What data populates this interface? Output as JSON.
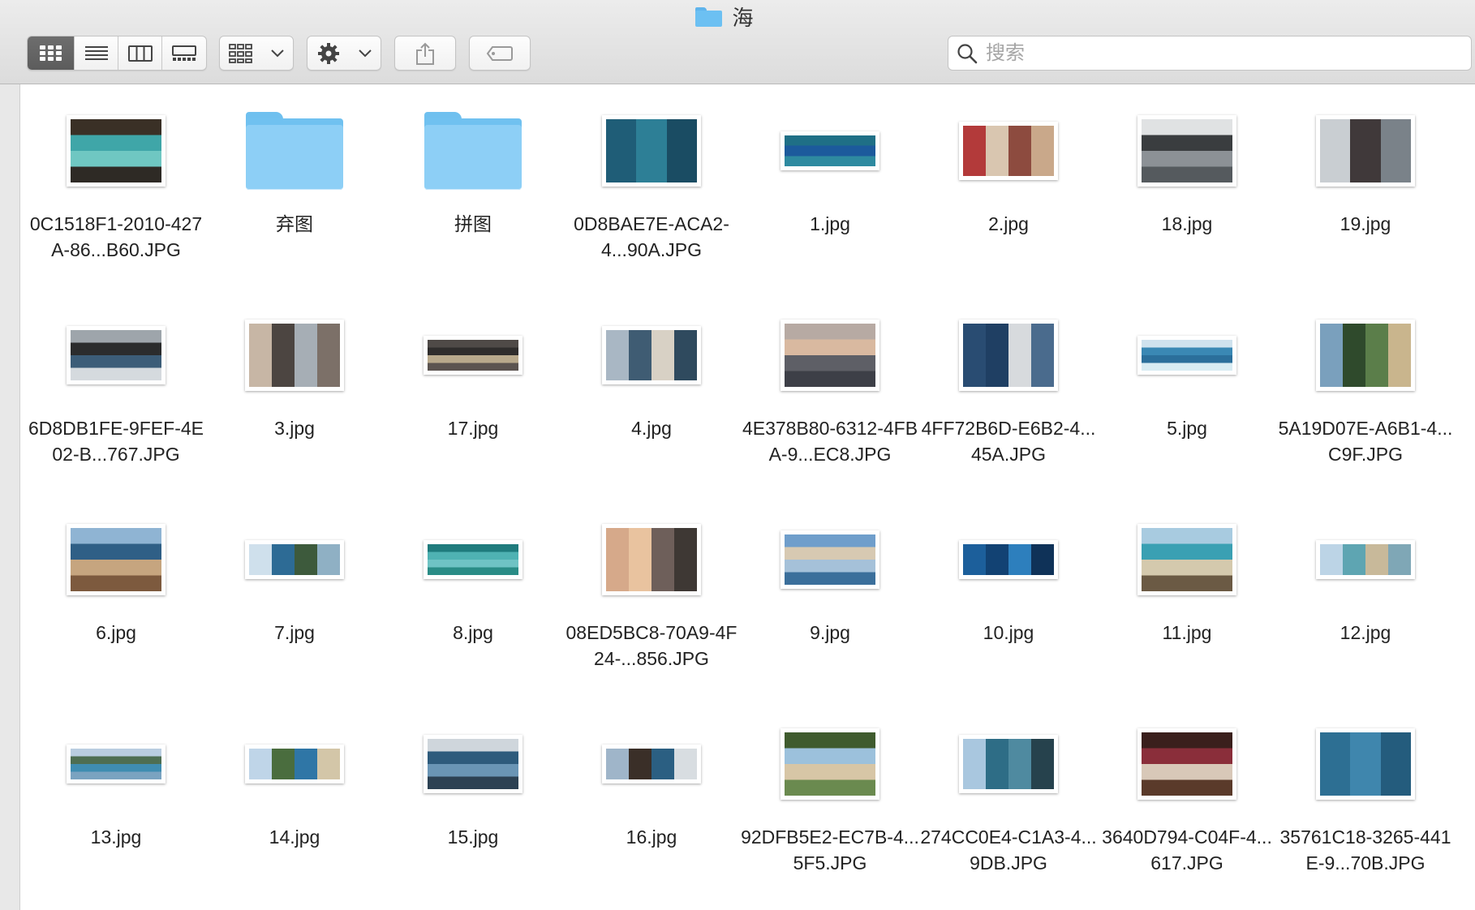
{
  "window": {
    "title": "海"
  },
  "toolbar": {
    "view_modes": [
      {
        "name": "icon-view-button",
        "icon": "grid-icon",
        "active": true
      },
      {
        "name": "list-view-button",
        "icon": "list-icon",
        "active": false
      },
      {
        "name": "column-view-button",
        "icon": "columns-icon",
        "active": false
      },
      {
        "name": "gallery-view-button",
        "icon": "gallery-icon",
        "active": false
      }
    ],
    "group_button_icon": "group-grid-icon",
    "action_button_icon": "gear-icon",
    "share_button_icon": "share-icon",
    "tag_button_icon": "tag-icon"
  },
  "search": {
    "placeholder": "搜索",
    "value": ""
  },
  "files": [
    {
      "label": "0C1518F1-2010-427A-86...B60.JPG",
      "kind": "image",
      "colors": [
        "#3a3026",
        "#3fa6a8",
        "#6fc7c2",
        "#2e2a25"
      ]
    },
    {
      "label": "弃图",
      "kind": "folder"
    },
    {
      "label": "拼图",
      "kind": "folder"
    },
    {
      "label": "0D8BAE7E-ACA2-4...90A.JPG",
      "kind": "image",
      "colors": [
        "#1f5d77",
        "#2d7f96",
        "#1a4c63"
      ]
    },
    {
      "label": "1.jpg",
      "kind": "image",
      "shape": "wide",
      "colors": [
        "#1f6f86",
        "#1c5a9c",
        "#2e8aa0"
      ]
    },
    {
      "label": "2.jpg",
      "kind": "image",
      "colors": [
        "#b33a3a",
        "#d9c6b0",
        "#8d4b3f",
        "#c9a88a"
      ]
    },
    {
      "label": "18.jpg",
      "kind": "image",
      "colors": [
        "#e0e2e3",
        "#3a3d3f",
        "#8c9196",
        "#555a5e"
      ]
    },
    {
      "label": "19.jpg",
      "kind": "image",
      "colors": [
        "#c9ced2",
        "#40393a",
        "#7a8289"
      ]
    },
    {
      "label": "6D8DB1FE-9FEF-4E02-B...767.JPG",
      "kind": "image",
      "colors": [
        "#9ea5ab",
        "#2b2c2d",
        "#3c5d78",
        "#d5dade"
      ]
    },
    {
      "label": "3.jpg",
      "kind": "image",
      "colors": [
        "#c7b6a5",
        "#4c4541",
        "#a6aeb5",
        "#7c7068"
      ]
    },
    {
      "label": "17.jpg",
      "kind": "image",
      "shape": "wide",
      "colors": [
        "#4f4a47",
        "#2f2d2c",
        "#b8a98c",
        "#5b5450"
      ]
    },
    {
      "label": "4.jpg",
      "kind": "image",
      "colors": [
        "#a9b7c4",
        "#3f5c73",
        "#d8d1c5",
        "#2f4a5e"
      ]
    },
    {
      "label": "4E378B80-6312-4FBA-9...EC8.JPG",
      "kind": "image",
      "colors": [
        "#b7aaa3",
        "#d9b9a0",
        "#5e5f66",
        "#3d3f47"
      ]
    },
    {
      "label": "4FF72B6D-E6B2-4...45A.JPG",
      "kind": "image",
      "colors": [
        "#294c72",
        "#1f3f63",
        "#d7dadd",
        "#4a6b8d"
      ]
    },
    {
      "label": "5.jpg",
      "kind": "image",
      "shape": "wide",
      "colors": [
        "#cfe2ee",
        "#3a88b4",
        "#2b6f9b",
        "#d8ecf3"
      ]
    },
    {
      "label": "5A19D07E-A6B1-4...C9F.JPG",
      "kind": "image",
      "colors": [
        "#7aa0bd",
        "#2f4a2c",
        "#5b7e4a",
        "#c9b58d"
      ]
    },
    {
      "label": "6.jpg",
      "kind": "image",
      "colors": [
        "#8fb4d3",
        "#2f5f86",
        "#c6a57f",
        "#7d5a3e"
      ]
    },
    {
      "label": "7.jpg",
      "kind": "image",
      "shape": "wide",
      "colors": [
        "#cfe0ec",
        "#2d6b95",
        "#3d5a3c",
        "#8fb0c4"
      ]
    },
    {
      "label": "8.jpg",
      "kind": "image",
      "shape": "wide",
      "colors": [
        "#1f7b7d",
        "#4fb2b3",
        "#6fc3c4",
        "#2a8c86"
      ]
    },
    {
      "label": "08ED5BC8-70A9-4F24-...856.JPG",
      "kind": "image",
      "colors": [
        "#d6a98a",
        "#e9c39f",
        "#6e5f5a",
        "#3e3834"
      ]
    },
    {
      "label": "9.jpg",
      "kind": "image",
      "colors": [
        "#6f9ecb",
        "#d7c9b2",
        "#a5c1d9",
        "#3b6f9b"
      ]
    },
    {
      "label": "10.jpg",
      "kind": "image",
      "shape": "wide",
      "colors": [
        "#1c5f9b",
        "#124273",
        "#2d7fbd",
        "#0f3258"
      ]
    },
    {
      "label": "11.jpg",
      "kind": "image",
      "colors": [
        "#a8cbe0",
        "#3aa0b3",
        "#d4c9ad",
        "#6b5a44"
      ]
    },
    {
      "label": "12.jpg",
      "kind": "image",
      "shape": "wide",
      "colors": [
        "#bcd4e6",
        "#5ea5b2",
        "#c8b99a",
        "#7fa7b6"
      ]
    },
    {
      "label": "13.jpg",
      "kind": "image",
      "shape": "wide",
      "colors": [
        "#b9cde0",
        "#4e6e52",
        "#3f8db1",
        "#7aa3c0"
      ]
    },
    {
      "label": "14.jpg",
      "kind": "image",
      "shape": "wide",
      "colors": [
        "#bfd5e8",
        "#4a6d3e",
        "#2f76a6",
        "#d3c6a8"
      ]
    },
    {
      "label": "15.jpg",
      "kind": "image",
      "colors": [
        "#cfd6dc",
        "#2e5b7c",
        "#6a95b5",
        "#2c4153"
      ]
    },
    {
      "label": "16.jpg",
      "kind": "image",
      "shape": "wide",
      "colors": [
        "#9fb5c9",
        "#3a2f28",
        "#2b5f82",
        "#d8dde1"
      ]
    },
    {
      "label": "92DFB5E2-EC7B-4...5F5.JPG",
      "kind": "image",
      "colors": [
        "#3f5b2e",
        "#9cc1dc",
        "#d7c6a6",
        "#6a8a4f"
      ]
    },
    {
      "label": "274CC0E4-C1A3-4...9DB.JPG",
      "kind": "image",
      "colors": [
        "#a9c7df",
        "#2e6d86",
        "#4f8aa0",
        "#26424d"
      ]
    },
    {
      "label": "3640D794-C04F-4...617.JPG",
      "kind": "image",
      "colors": [
        "#3a1f1c",
        "#8a2e3a",
        "#d8c8b8",
        "#5a3a2a"
      ]
    },
    {
      "label": "35761C18-3265-441E-9...70B.JPG",
      "kind": "image",
      "colors": [
        "#2d6f93",
        "#3f86ad",
        "#245c7d"
      ]
    }
  ]
}
